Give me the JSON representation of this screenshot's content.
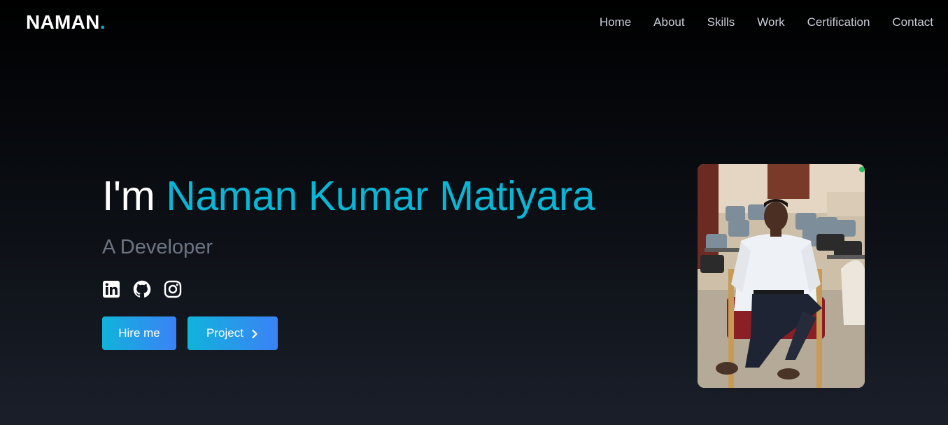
{
  "brand": {
    "name": "NAMAN",
    "dot": "."
  },
  "nav": {
    "items": [
      {
        "label": "Home"
      },
      {
        "label": "About"
      },
      {
        "label": "Skills"
      },
      {
        "label": "Work"
      },
      {
        "label": "Certification"
      },
      {
        "label": "Contact"
      }
    ]
  },
  "hero": {
    "greeting": "I'm",
    "name": "Naman Kumar Matiyara",
    "subtitle": "A Developer",
    "socials": [
      {
        "icon": "linkedin-icon"
      },
      {
        "icon": "github-icon"
      },
      {
        "icon": "instagram-icon"
      }
    ],
    "buttons": {
      "hire_label": "Hire me",
      "project_label": "Project"
    }
  },
  "colors": {
    "accent": "#08b6d6",
    "subtitle": "#6e7582",
    "button_from": "#10b3db",
    "button_to": "#3b82f6"
  }
}
